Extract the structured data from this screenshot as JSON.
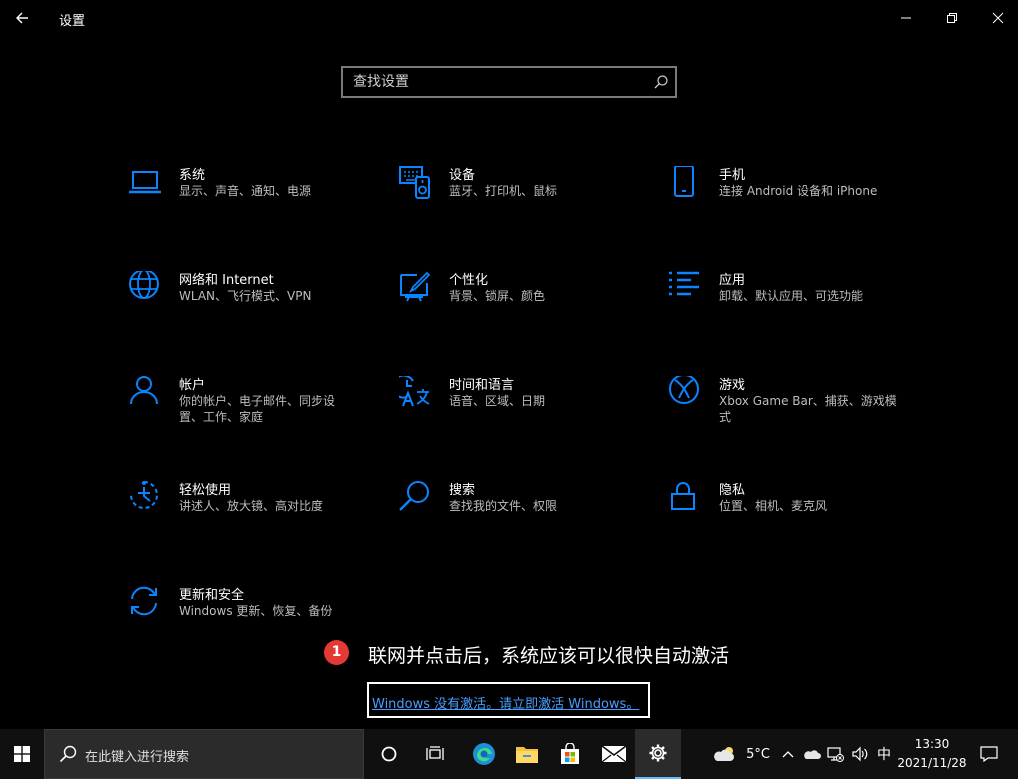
{
  "window": {
    "title": "设置",
    "back_icon": "back-arrow-icon",
    "minimize_icon": "minimize-icon",
    "restore_icon": "restore-icon",
    "close_icon": "close-icon"
  },
  "search": {
    "placeholder": "查找设置",
    "value": ""
  },
  "accent": "#0a84ff",
  "categories": [
    {
      "title": "系统",
      "desc": "显示、声音、通知、电源",
      "icon": "laptop-icon"
    },
    {
      "title": "设备",
      "desc": "蓝牙、打印机、鼠标",
      "icon": "devices-icon"
    },
    {
      "title": "手机",
      "desc": "连接 Android 设备和 iPhone",
      "icon": "phone-icon"
    },
    {
      "title": "网络和 Internet",
      "desc": "WLAN、飞行模式、VPN",
      "icon": "globe-icon"
    },
    {
      "title": "个性化",
      "desc": "背景、锁屏、颜色",
      "icon": "personalization-icon"
    },
    {
      "title": "应用",
      "desc": "卸载、默认应用、可选功能",
      "icon": "apps-list-icon"
    },
    {
      "title": "帐户",
      "desc": "你的帐户、电子邮件、同步设置、工作、家庭",
      "icon": "person-icon"
    },
    {
      "title": "时间和语言",
      "desc": "语音、区域、日期",
      "icon": "time-language-icon"
    },
    {
      "title": "游戏",
      "desc": "Xbox Game Bar、捕获、游戏模式",
      "icon": "xbox-icon"
    },
    {
      "title": "轻松使用",
      "desc": "讲述人、放大镜、高对比度",
      "icon": "ease-of-access-icon"
    },
    {
      "title": "搜索",
      "desc": "查找我的文件、权限",
      "icon": "search-icon"
    },
    {
      "title": "隐私",
      "desc": "位置、相机、麦克风",
      "icon": "lock-icon"
    },
    {
      "title": "更新和安全",
      "desc": "Windows 更新、恢复、备份",
      "icon": "sync-icon"
    }
  ],
  "annotation": {
    "badge": "1",
    "text": "联网并点击后，系统应该可以很快自动激活",
    "badge_color": "#e53935"
  },
  "activation_link": "Windows 没有激活。请立即激活 Windows。",
  "taskbar": {
    "search_placeholder": "在此键入进行搜索",
    "weather": "5°C",
    "ime": "中",
    "time": "13:30",
    "date": "2021/11/28"
  }
}
